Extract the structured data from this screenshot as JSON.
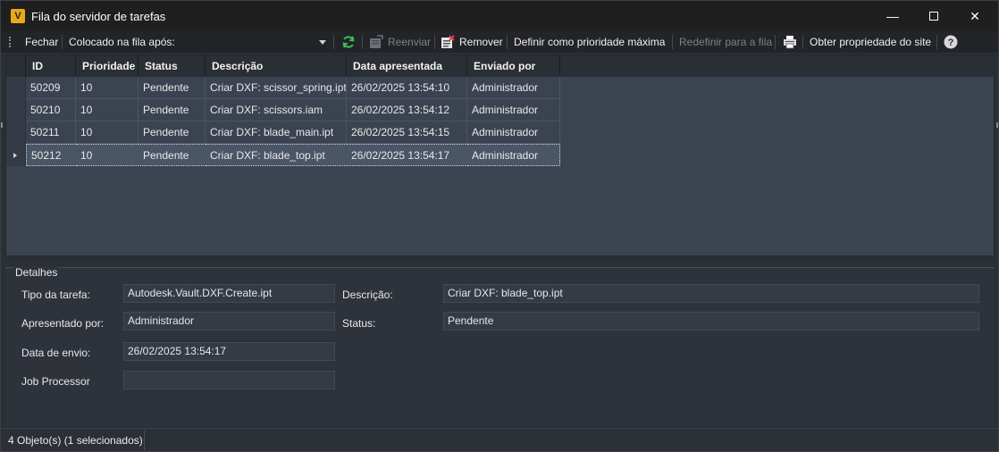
{
  "window": {
    "title": "Fila do servidor de tarefas",
    "app_icon_label": "V",
    "minimize_glyph": "—",
    "close_glyph": "✕"
  },
  "toolbar": {
    "close_label": "Fechar",
    "queued_after_label": "Colocado na fila após:",
    "resend_label": "Reenviar",
    "remove_label": "Remover",
    "set_max_priority_label": "Definir como prioridade máxima",
    "requeue_label": "Redefinir para a fila",
    "site_ownership_label": "Obter propriedade do site",
    "help_glyph": "?"
  },
  "grid": {
    "columns": [
      "ID",
      "Prioridade",
      "Status",
      "Descrição",
      "Data apresentada",
      "Enviado por"
    ],
    "rows": [
      {
        "id": "50209",
        "priority": "10",
        "status": "Pendente",
        "description": "Criar DXF: scissor_spring.ipt",
        "date": "26/02/2025 13:54:10",
        "sent_by": "Administrador"
      },
      {
        "id": "50210",
        "priority": "10",
        "status": "Pendente",
        "description": "Criar DXF: scissors.iam",
        "date": "26/02/2025 13:54:12",
        "sent_by": "Administrador"
      },
      {
        "id": "50211",
        "priority": "10",
        "status": "Pendente",
        "description": "Criar DXF: blade_main.ipt",
        "date": "26/02/2025 13:54:15",
        "sent_by": "Administrador"
      },
      {
        "id": "50212",
        "priority": "10",
        "status": "Pendente",
        "description": "Criar DXF: blade_top.ipt",
        "date": "26/02/2025 13:54:17",
        "sent_by": "Administrador"
      }
    ],
    "selected_index": 3
  },
  "details": {
    "title": "Detalhes",
    "task_type_label": "Tipo da tarefa:",
    "task_type_value": "Autodesk.Vault.DXF.Create.ipt",
    "submitted_by_label": "Apresentado por:",
    "submitted_by_value": "Administrador",
    "send_date_label": "Data de envio:",
    "send_date_value": "26/02/2025 13:54:17",
    "job_processor_label": "Job Processor",
    "job_processor_value": "",
    "description_label": "Descrição:",
    "description_value": "Criar DXF: blade_top.ipt",
    "status_label": "Status:",
    "status_value": "Pendente"
  },
  "statusbar": {
    "text": "4 Objeto(s) (1 selecionados)"
  },
  "colors": {
    "accent_refresh": "#3fbf5a",
    "app_icon": "#e8a91a"
  },
  "icons": [
    "vault-app-icon",
    "refresh-icon",
    "resend-icon",
    "remove-icon",
    "print-icon",
    "help-icon"
  ]
}
